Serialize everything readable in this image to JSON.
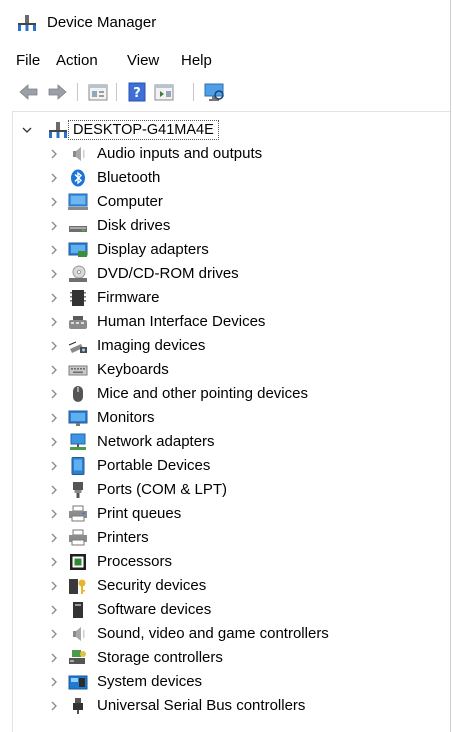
{
  "window": {
    "title": "Device Manager"
  },
  "menu": {
    "items": [
      "File",
      "Action",
      "View",
      "Help"
    ]
  },
  "toolbar": {
    "buttons": [
      "back-icon",
      "forward-icon",
      "properties-icon",
      "help-icon",
      "show-hide-console-tree-icon",
      "scan-for-hardware-changes-icon"
    ]
  },
  "tree": {
    "root": "DESKTOP-G41MA4E",
    "categories": [
      {
        "label": "Audio inputs and outputs",
        "icon": "speaker-icon"
      },
      {
        "label": "Bluetooth",
        "icon": "bluetooth-icon"
      },
      {
        "label": "Computer",
        "icon": "computer-icon"
      },
      {
        "label": "Disk drives",
        "icon": "disk-drive-icon"
      },
      {
        "label": "Display adapters",
        "icon": "display-adapter-icon"
      },
      {
        "label": "DVD/CD-ROM drives",
        "icon": "dvd-drive-icon"
      },
      {
        "label": "Firmware",
        "icon": "firmware-icon"
      },
      {
        "label": "Human Interface Devices",
        "icon": "hid-icon"
      },
      {
        "label": "Imaging devices",
        "icon": "camera-icon"
      },
      {
        "label": "Keyboards",
        "icon": "keyboard-icon"
      },
      {
        "label": "Mice and other pointing devices",
        "icon": "mouse-icon"
      },
      {
        "label": "Monitors",
        "icon": "monitor-icon"
      },
      {
        "label": "Network adapters",
        "icon": "network-adapter-icon"
      },
      {
        "label": "Portable Devices",
        "icon": "portable-device-icon"
      },
      {
        "label": "Ports (COM & LPT)",
        "icon": "port-icon"
      },
      {
        "label": "Print queues",
        "icon": "print-queue-icon"
      },
      {
        "label": "Printers",
        "icon": "printer-icon"
      },
      {
        "label": "Processors",
        "icon": "processor-icon"
      },
      {
        "label": "Security devices",
        "icon": "security-device-icon"
      },
      {
        "label": "Software devices",
        "icon": "software-device-icon"
      },
      {
        "label": "Sound, video and game controllers",
        "icon": "sound-controller-icon"
      },
      {
        "label": "Storage controllers",
        "icon": "storage-controller-icon"
      },
      {
        "label": "System devices",
        "icon": "system-device-icon"
      },
      {
        "label": "Universal Serial Bus controllers",
        "icon": "usb-icon"
      }
    ]
  }
}
